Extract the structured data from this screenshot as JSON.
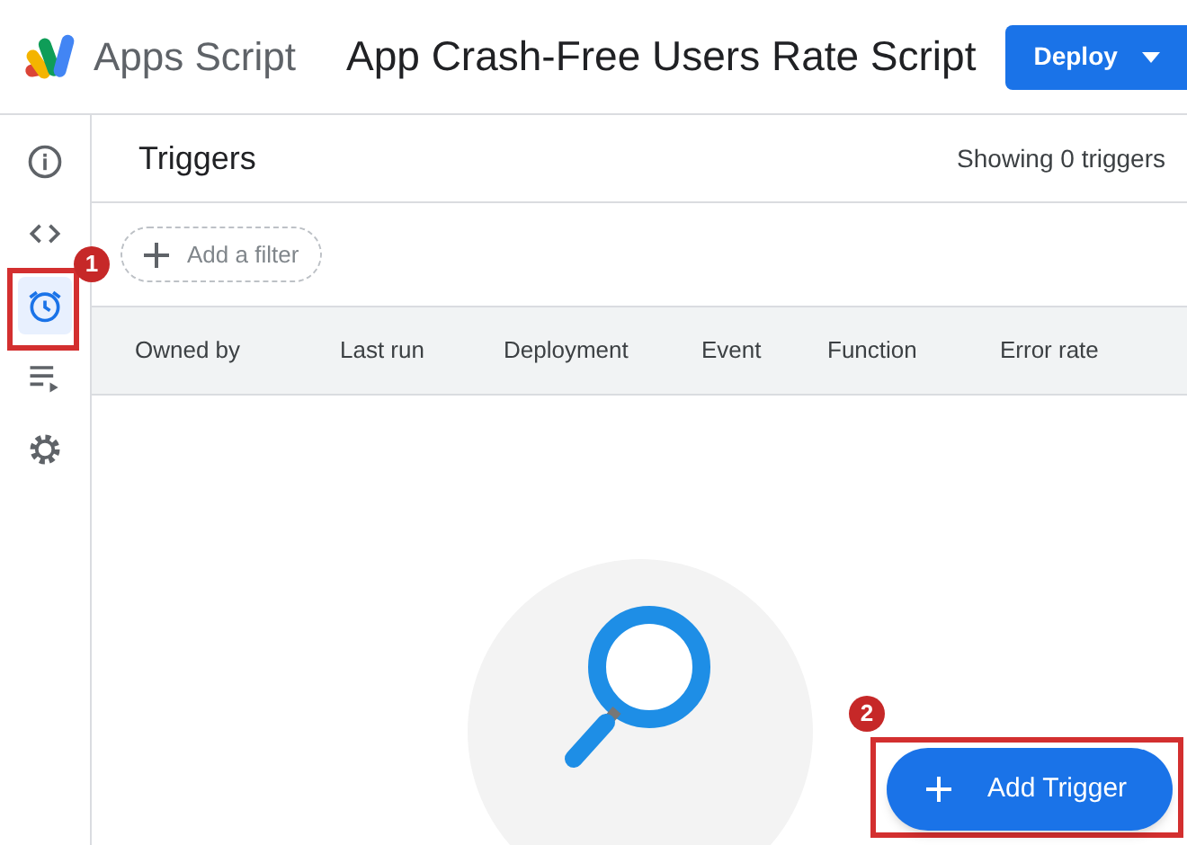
{
  "header": {
    "app_name": "Apps Script",
    "project_title": "App Crash-Free Users Rate Script",
    "deploy_button": "Deploy"
  },
  "sidebar": {
    "items": [
      {
        "kind": "info",
        "selected": false
      },
      {
        "kind": "editor",
        "selected": false
      },
      {
        "kind": "triggers",
        "selected": true,
        "callout": "1"
      },
      {
        "kind": "executions",
        "selected": false
      },
      {
        "kind": "settings",
        "selected": false
      }
    ]
  },
  "triggers": {
    "title": "Triggers",
    "count": "Showing 0 triggers",
    "filter_chip": "Add a filter",
    "columns": [
      "Owned by",
      "Last run",
      "Deployment",
      "Event",
      "Function",
      "Error rate"
    ],
    "add_button": {
      "label": "Add Trigger",
      "callout": "2"
    }
  }
}
